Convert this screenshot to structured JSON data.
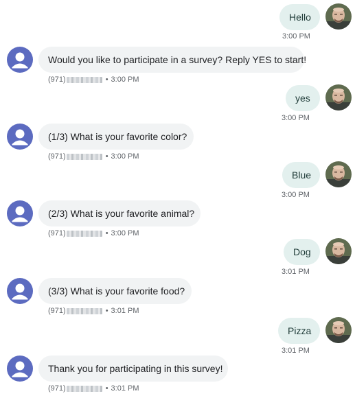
{
  "messages": [
    {
      "text": "Hello",
      "time": "3:00 PM"
    },
    {
      "text": "Would you like to participate in a survey? Reply YES to start!",
      "sender_prefix": "(971)",
      "time": "3:00 PM"
    },
    {
      "text": "yes",
      "time": "3:00 PM"
    },
    {
      "text": "(1/3) What is your favorite color?",
      "sender_prefix": "(971)",
      "time": "3:00 PM"
    },
    {
      "text": "Blue",
      "time": "3:00 PM"
    },
    {
      "text": "(2/3) What is your favorite animal?",
      "sender_prefix": "(971)",
      "time": "3:00 PM"
    },
    {
      "text": "Dog",
      "time": "3:01 PM"
    },
    {
      "text": "(3/3) What is your favorite food?",
      "sender_prefix": "(971)",
      "time": "3:01 PM"
    },
    {
      "text": "Pizza",
      "time": "3:01 PM"
    },
    {
      "text": "Thank you for participating in this survey!",
      "sender_prefix": "(971)",
      "time": "3:01 PM"
    }
  ],
  "colors": {
    "outgoing_bubble": "#e3f0ee",
    "incoming_bubble": "#f1f3f4",
    "contact_avatar": "#5c6bc0"
  },
  "icons": {
    "contact_avatar": "person-icon",
    "user_avatar": "user-photo"
  }
}
